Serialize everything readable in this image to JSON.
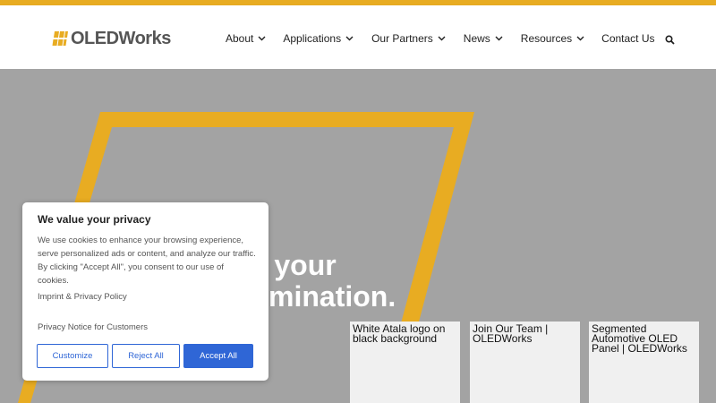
{
  "brand": {
    "name": "OLEDWorks",
    "accent_color": "#e8ac22",
    "text_color": "#555555"
  },
  "nav": {
    "items": [
      {
        "label": "About",
        "dropdown": true
      },
      {
        "label": "Applications",
        "dropdown": true
      },
      {
        "label": "Our Partners",
        "dropdown": true
      },
      {
        "label": "News",
        "dropdown": true
      },
      {
        "label": "Resources",
        "dropdown": true
      },
      {
        "label": "Contact Us",
        "dropdown": false
      }
    ],
    "search_icon": "search-icon"
  },
  "hero": {
    "line1": "r your",
    "line2": "mination.",
    "background_color": "#a3a3a3"
  },
  "cards": [
    {
      "label": "White Atala logo on black background"
    },
    {
      "label": "Join Our Team | OLEDWorks"
    },
    {
      "label": "Segmented Automotive OLED Panel | OLEDWorks"
    }
  ],
  "cookie_banner": {
    "title": "We value your privacy",
    "body": "We use cookies to enhance your browsing experience, serve personalized ads or content, and analyze our traffic. By clicking \"Accept All\", you consent to our use of cookies.",
    "link_imprint": "Imprint & Privacy Policy",
    "link_notice": "Privacy Notice for Customers",
    "btn_customize": "Customize",
    "btn_reject": "Reject All",
    "btn_accept": "Accept All",
    "button_color": "#2f66d6"
  }
}
